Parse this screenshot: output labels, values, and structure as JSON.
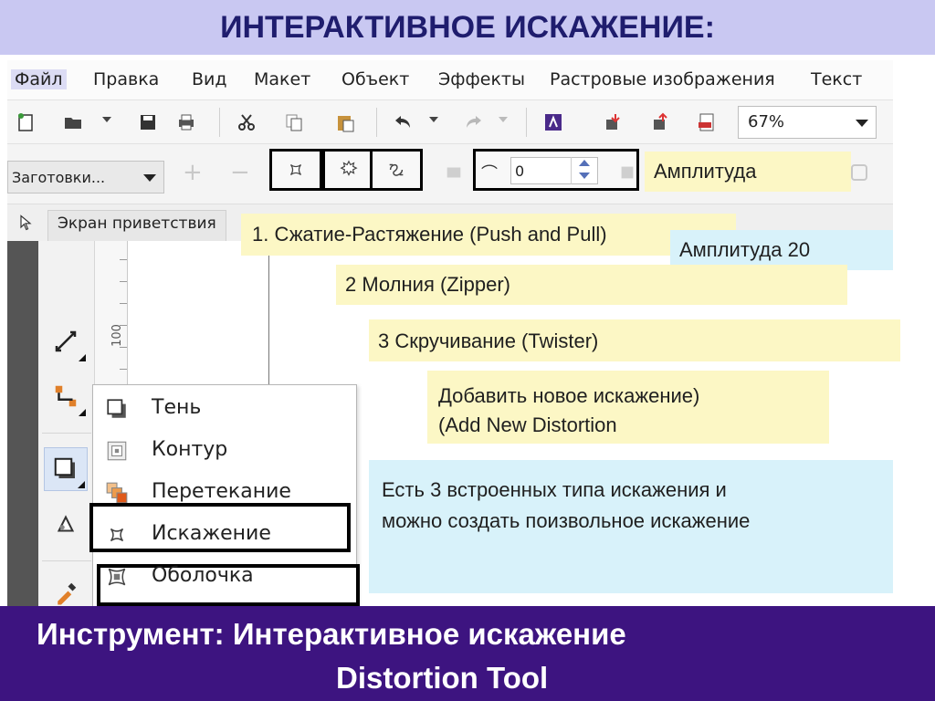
{
  "slide_title": "ИНТЕРАКТИВНОЕ ИСКАЖЕНИЕ:",
  "menu": [
    "Файл",
    "Правка",
    "Вид",
    "Макет",
    "Объект",
    "Эффекты",
    "Растровые изображения",
    "Текст"
  ],
  "toolbar": {
    "icons": [
      "new-document-icon",
      "open-icon",
      "save-icon",
      "print-icon",
      "cut-icon",
      "copy-icon",
      "paste-icon",
      "undo-icon",
      "redo-icon",
      "app-launcher-icon",
      "import-icon",
      "export-icon",
      "publish-pdf-icon"
    ],
    "zoom": "67%"
  },
  "property_bar": {
    "preset": "Заготовки...",
    "add": "+",
    "remove": "−",
    "amplitude_value": "0"
  },
  "tabs": {
    "welcome": "Экран приветствия"
  },
  "ruler": {
    "labels": [
      "100"
    ]
  },
  "flyout": {
    "items": [
      "Тень",
      "Контур",
      "Перетекание",
      "Искажение",
      "Оболочка"
    ]
  },
  "callouts": {
    "amplitude": "Амплитуда",
    "push_pull": "1. Сжатие-Растяжение (Push and Pull)",
    "amplitude_20": "Амплитуда 20",
    "zipper": "2 Молния  (Zipper)",
    "twister": "3 Скручивание (Twister)",
    "add_line1": "Добавить новое искажение)",
    "add_line2": "(Add New Distortion",
    "info_line1": "Есть 3 встроенных типа искажения и",
    "info_line2": "можно создать поизвольное искажение"
  },
  "footer": {
    "line1": "Инструмент: Интерактивное искажение",
    "line2": "Distortion Tool"
  },
  "colors": {
    "title_bg": "#c9c8f2",
    "title_text": "#1f1d6e",
    "footer_bg": "#3d1480",
    "callout_yellow": "#fcf7c5",
    "callout_blue": "#d8f2fa"
  }
}
